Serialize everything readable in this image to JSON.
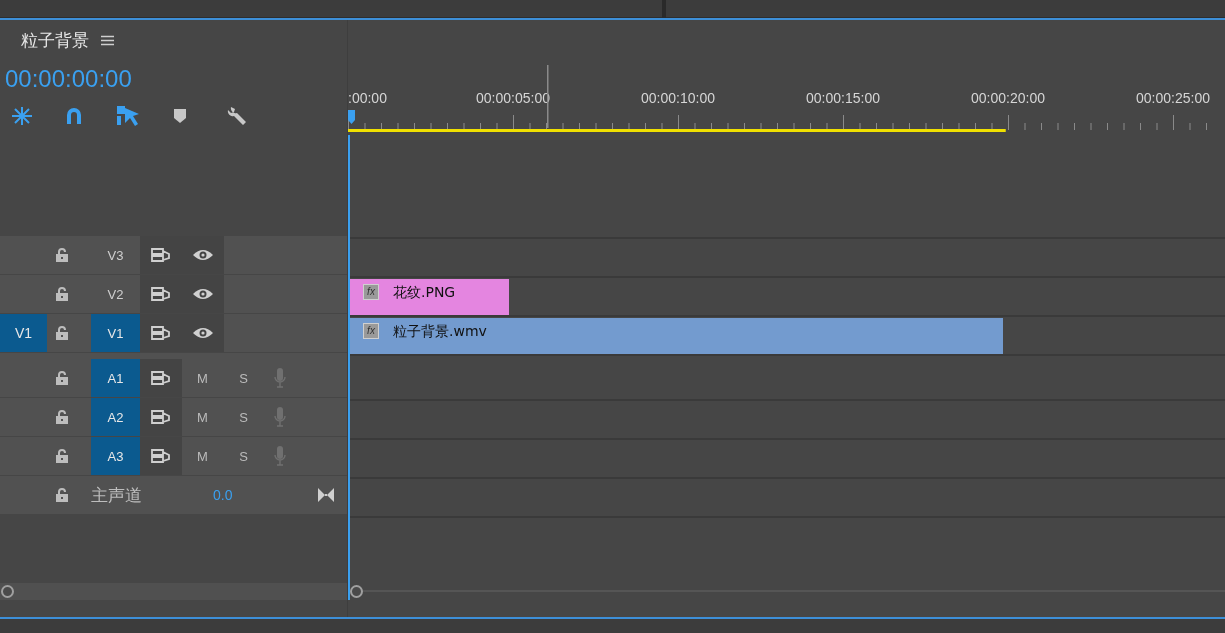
{
  "sequence": {
    "title": "粒子背景",
    "timecode": "00:00:00:00"
  },
  "ruler": {
    "labels": [
      ":00:00",
      "00:00:05:00",
      "00:00:10:00",
      "00:00:15:00",
      "00:00:20:00",
      "00:00:25:00"
    ],
    "work_area": {
      "level": 0.75
    }
  },
  "tracks": [
    {
      "kind": "video",
      "label": "V3",
      "targeted": false
    },
    {
      "kind": "video",
      "label": "V2",
      "targeted": false,
      "clips": [
        {
          "name": "花纹.PNG",
          "badge": "fx",
          "color": "#e485e0"
        }
      ]
    },
    {
      "kind": "video",
      "label": "V1",
      "source_patch": "V1",
      "targeted": true,
      "clips": [
        {
          "name": "粒子背景.wmv",
          "badge": "fx",
          "color": "#739bcf"
        }
      ]
    },
    {
      "kind": "audio",
      "label": "A1",
      "targeted": true,
      "mute": "M",
      "solo": "S"
    },
    {
      "kind": "audio",
      "label": "A2",
      "targeted": true,
      "mute": "M",
      "solo": "S"
    },
    {
      "kind": "audio",
      "label": "A3",
      "targeted": true,
      "mute": "M",
      "solo": "S"
    },
    {
      "kind": "master",
      "label": "主声道",
      "value": "0.0"
    }
  ]
}
